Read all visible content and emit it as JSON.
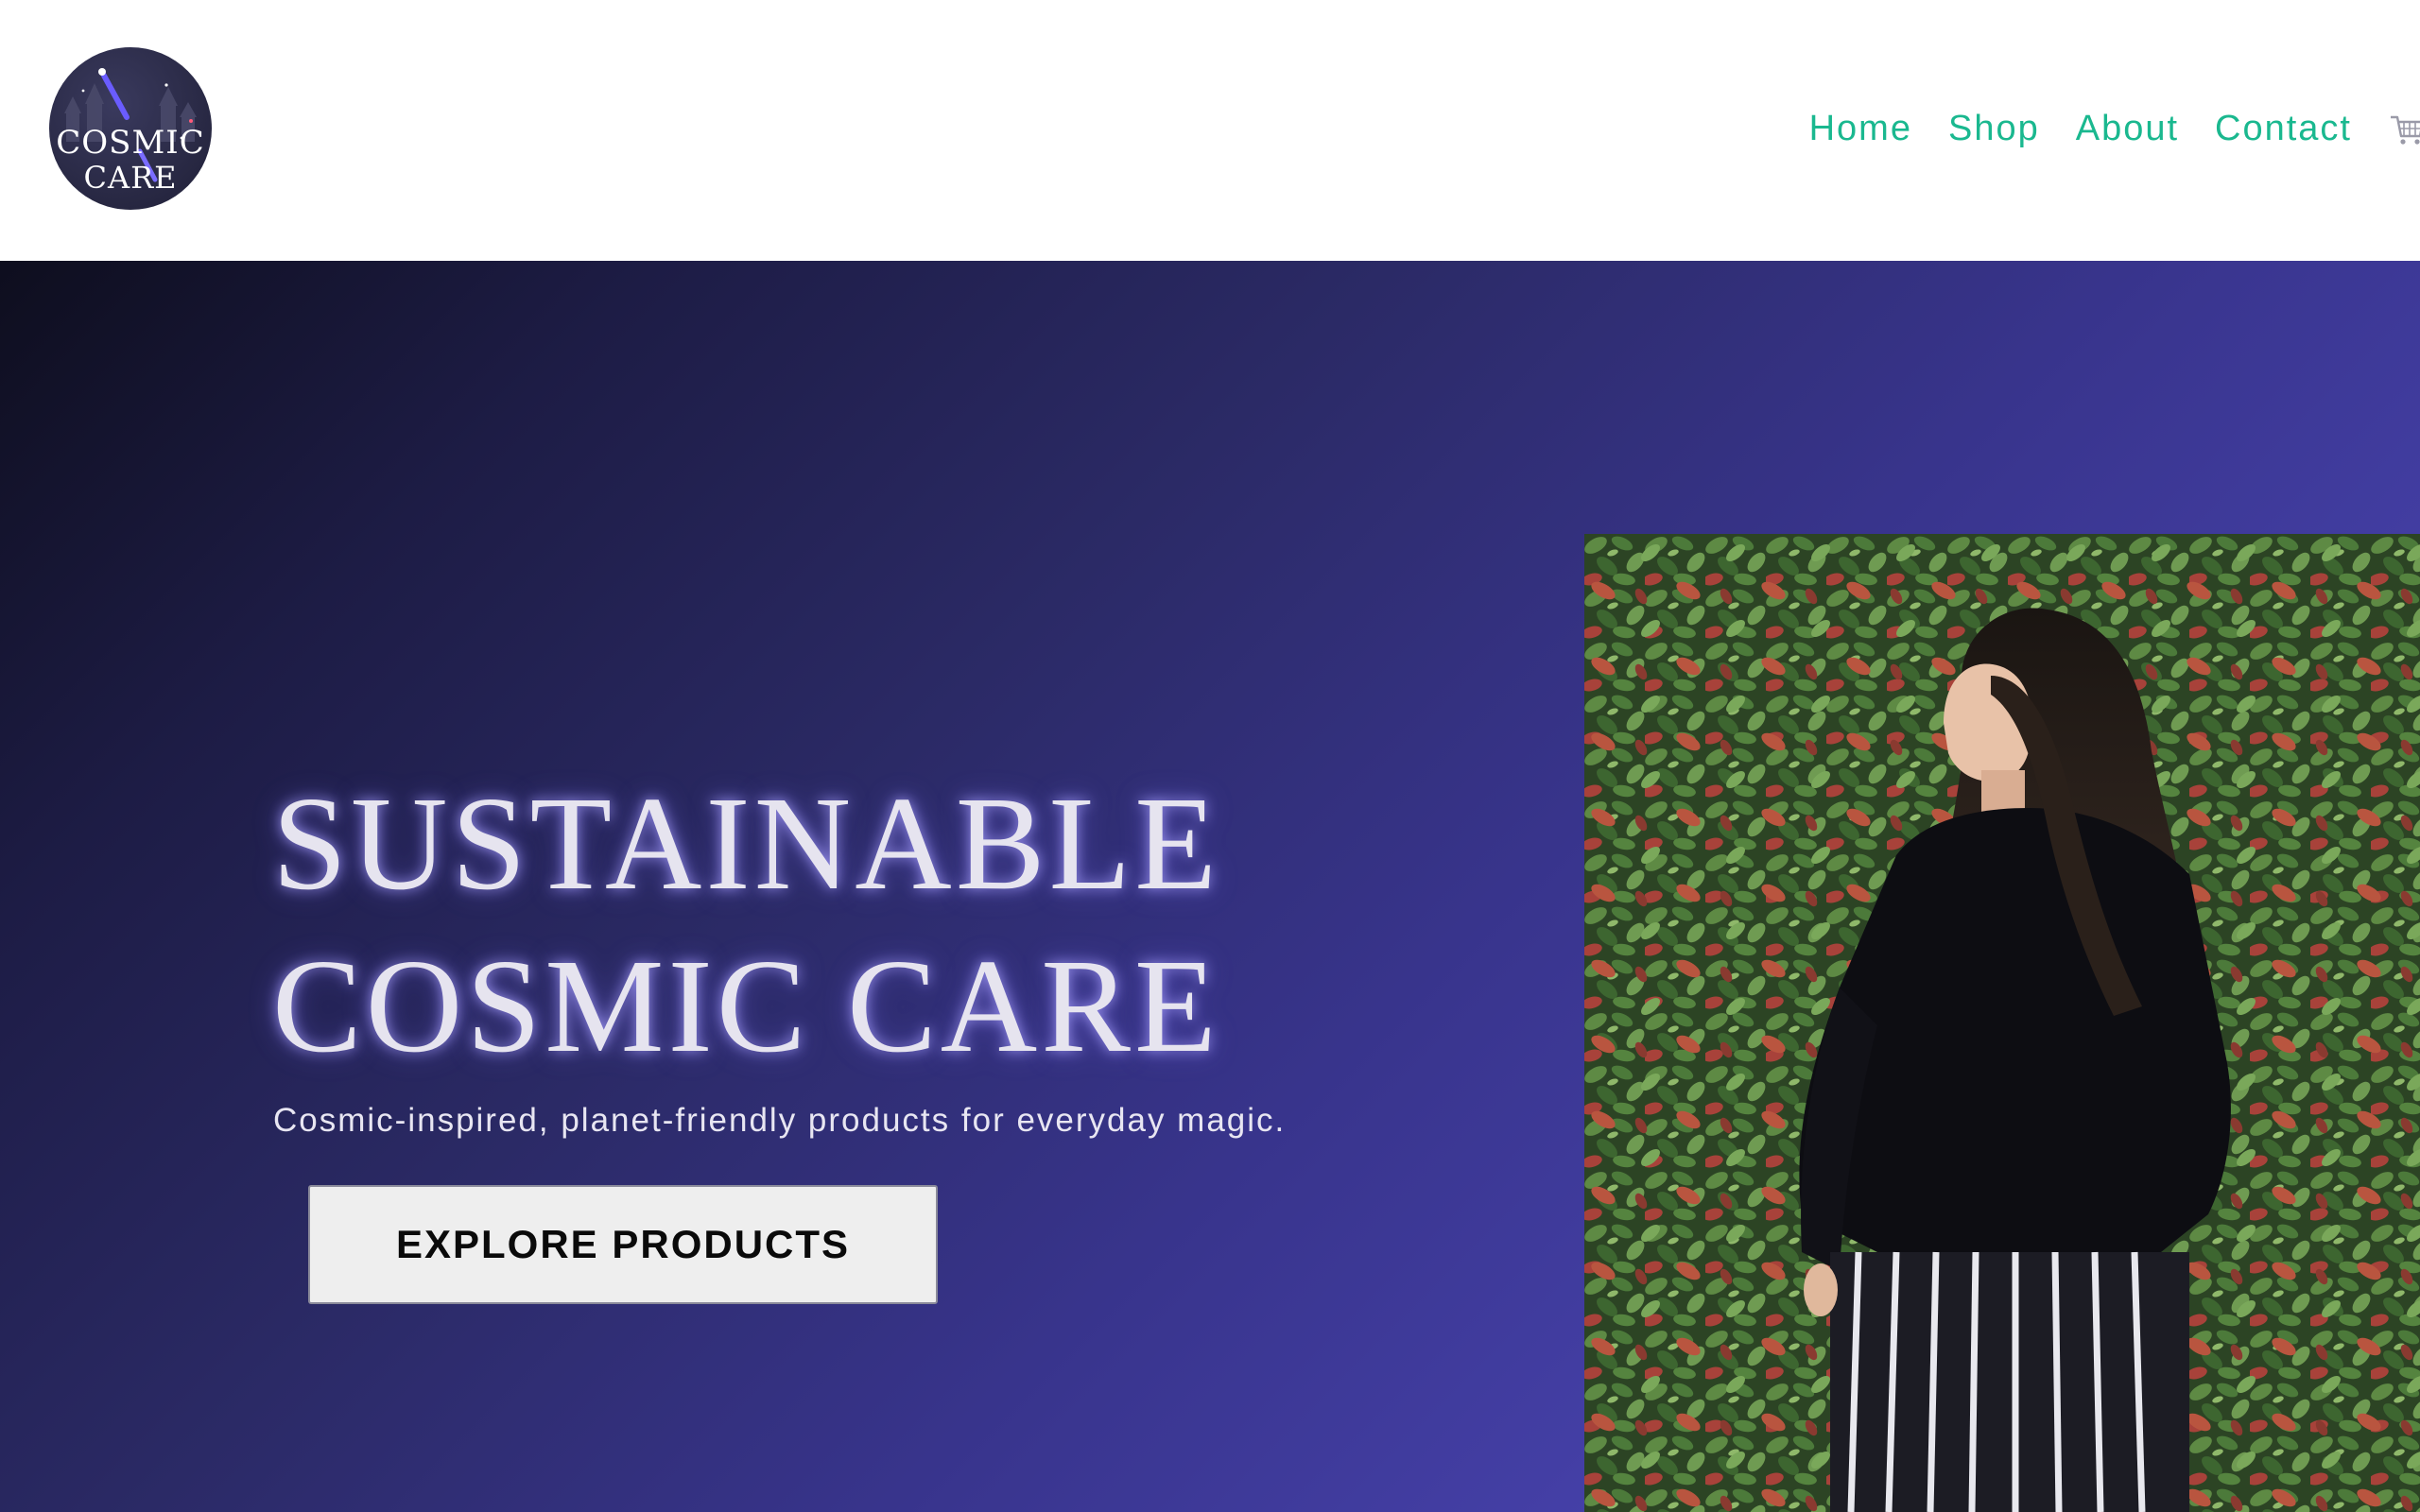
{
  "header": {
    "logo": {
      "line1": "COSMIC",
      "line2": "CARE",
      "icon": "cosmic-care-logo"
    },
    "nav": [
      {
        "label": "Home"
      },
      {
        "label": "Shop"
      },
      {
        "label": "About"
      },
      {
        "label": "Contact"
      }
    ],
    "cart_icon": "shopping-cart-icon"
  },
  "hero": {
    "title_line1": "SUSTAINABLE",
    "title_line2": "COSMIC CARE",
    "subtitle": "Cosmic-inspired, planet-friendly products for everyday magic.",
    "cta_label": "EXPLORE PRODUCTS",
    "image": "woman-in-front-of-hedge-photo"
  },
  "colors": {
    "accent": "#1ab88f",
    "hero_gradient_start": "#0e0e1e",
    "hero_gradient_end": "#4a44b4",
    "title_color": "#e6e4ef",
    "title_glow": "#a8a0ff",
    "button_bg": "#eeeeee"
  }
}
